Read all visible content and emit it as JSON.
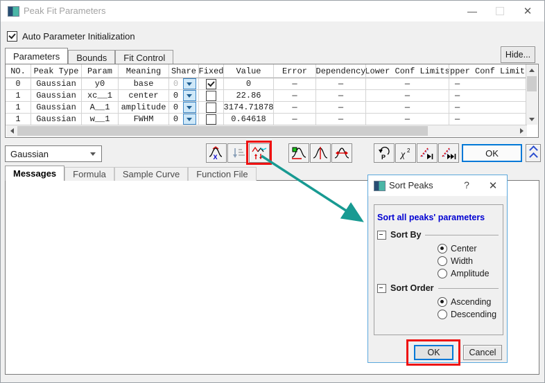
{
  "window": {
    "title": "Peak Fit Parameters",
    "minimize_glyph": "—",
    "close_glyph": "✕"
  },
  "auto_param": {
    "label": "Auto Parameter Initialization",
    "checked": true
  },
  "tabs_top": [
    {
      "label": "Parameters",
      "active": true
    },
    {
      "label": "Bounds",
      "active": false
    },
    {
      "label": "Fit Control",
      "active": false
    }
  ],
  "hide_button": "Hide...",
  "table": {
    "columns": [
      "NO.",
      "Peak Type",
      "Param",
      "Meaning",
      "Share",
      "Fixed",
      "Value",
      "Error",
      "Dependency",
      "Lower Conf Limits",
      "Upper Conf Limits"
    ],
    "rows": [
      {
        "no": "0",
        "type": "Gaussian",
        "param": "y0",
        "meaning": "base",
        "share": "0",
        "share_disabled": true,
        "fixed": true,
        "value": "0",
        "error": "—",
        "dep": "—",
        "lcl": "—",
        "ucl": "—"
      },
      {
        "no": "1",
        "type": "Gaussian",
        "param": "xc__1",
        "meaning": "center",
        "share": "0",
        "share_disabled": false,
        "fixed": false,
        "value": "22.86",
        "error": "—",
        "dep": "—",
        "lcl": "—",
        "ucl": "—"
      },
      {
        "no": "1",
        "type": "Gaussian",
        "param": "A__1",
        "meaning": "amplitude",
        "share": "0",
        "share_disabled": false,
        "fixed": false,
        "value": "3174.71878",
        "error": "—",
        "dep": "—",
        "lcl": "—",
        "ucl": "—"
      },
      {
        "no": "1",
        "type": "Gaussian",
        "param": "w__1",
        "meaning": "FWHM",
        "share": "0",
        "share_disabled": false,
        "fixed": false,
        "value": "0.64618",
        "error": "—",
        "dep": "—",
        "lcl": "—",
        "ucl": "—"
      }
    ]
  },
  "function_select": {
    "value": "Gaussian"
  },
  "toolbar": {
    "ok_label": "OK",
    "icons": [
      "fix-peak-parameters-icon",
      "sort-parameters-disabled-icon",
      "sort-peaks-icon",
      "initialize-parameters-icon",
      "peak-center-icon",
      "peak-width-icon",
      "revert-parameters-icon",
      "chi-square-icon",
      "fit-one-iteration-icon",
      "fit-until-converged-icon",
      "collapse-panel-icon"
    ]
  },
  "tabs_bottom": [
    {
      "label": "Messages",
      "active": true
    },
    {
      "label": "Formula",
      "active": false
    },
    {
      "label": "Sample Curve",
      "active": false
    },
    {
      "label": "Function File",
      "active": false
    }
  ],
  "sort_dialog": {
    "title": "Sort Peaks",
    "help_glyph": "?",
    "close_glyph": "✕",
    "description": "Sort all peaks' parameters",
    "sections": [
      {
        "label": "Sort By",
        "options": [
          {
            "label": "Center",
            "selected": true
          },
          {
            "label": "Width",
            "selected": false
          },
          {
            "label": "Amplitude",
            "selected": false
          }
        ]
      },
      {
        "label": "Sort Order",
        "options": [
          {
            "label": "Ascending",
            "selected": true
          },
          {
            "label": "Descending",
            "selected": false
          }
        ]
      }
    ],
    "ok_label": "OK",
    "cancel_label": "Cancel"
  },
  "annotation": {
    "arrow_color": "#189a92",
    "highlight_color": "#ee1111"
  }
}
